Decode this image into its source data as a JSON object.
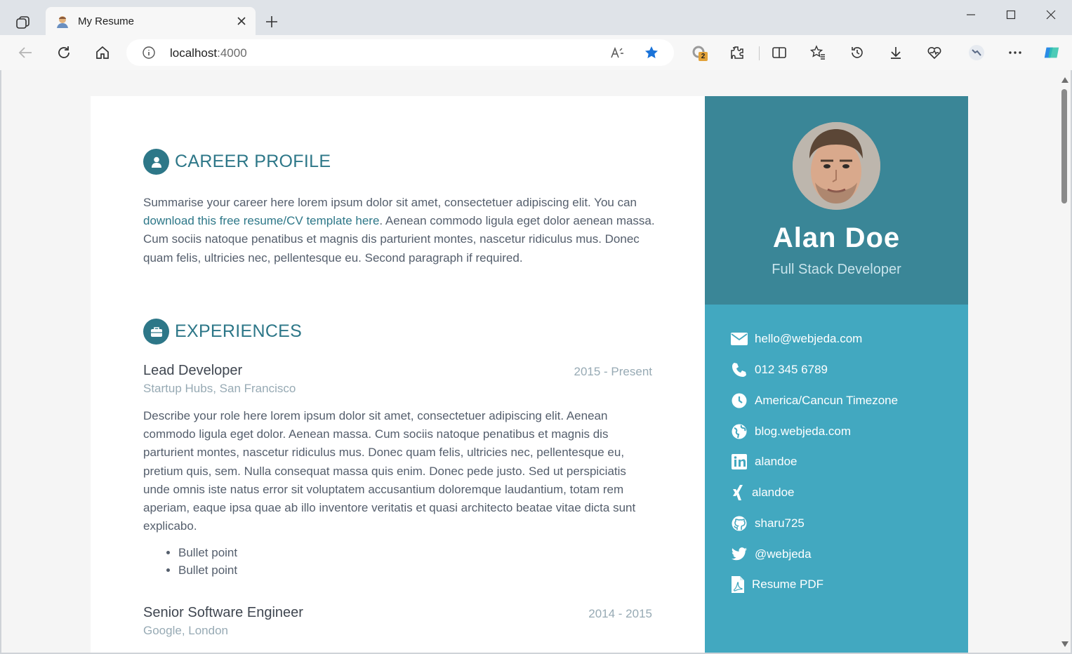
{
  "browser": {
    "tab": {
      "title": "My Resume"
    },
    "address": {
      "host": "localhost",
      "port": ":4000"
    },
    "extensions_badge": "2"
  },
  "profile": {
    "name": "Alan Doe",
    "tagline": "Full Stack Developer"
  },
  "contacts": [
    {
      "icon": "envelope-icon",
      "text": "hello@webjeda.com"
    },
    {
      "icon": "phone-icon",
      "text": "012 345 6789"
    },
    {
      "icon": "clock-icon",
      "text": "America/Cancun Timezone"
    },
    {
      "icon": "globe-icon",
      "text": "blog.webjeda.com"
    },
    {
      "icon": "linkedin-icon",
      "text": "alandoe"
    },
    {
      "icon": "xing-icon",
      "text": "alandoe"
    },
    {
      "icon": "github-icon",
      "text": "sharu725"
    },
    {
      "icon": "twitter-icon",
      "text": "@webjeda"
    },
    {
      "icon": "pdf-icon",
      "text": "Resume PDF"
    }
  ],
  "career_profile": {
    "title": "CAREER PROFILE",
    "summary_before": "Summarise your career here lorem ipsum dolor sit amet, consectetuer adipiscing elit. You can ",
    "summary_link": "download this free resume/CV template here",
    "summary_after": ". Aenean commodo ligula eget dolor aenean massa. Cum sociis natoque penatibus et magnis dis parturient montes, nascetur ridiculus mus. Donec quam felis, ultricies nec, pellentesque eu. Second paragraph if required."
  },
  "experiences": {
    "title": "EXPERIENCES",
    "items": [
      {
        "title": "Lead Developer",
        "time": "2015 - Present",
        "company": "Startup Hubs, San Francisco",
        "description": "Describe your role here lorem ipsum dolor sit amet, consectetuer adipiscing elit. Aenean commodo ligula eget dolor. Aenean massa. Cum sociis natoque penatibus et magnis dis parturient montes, nascetur ridiculus mus. Donec quam felis, ultricies nec, pellentesque eu, pretium quis, sem. Nulla consequat massa quis enim. Donec pede justo. Sed ut perspiciatis unde omnis iste natus error sit voluptatem accusantium doloremque laudantium, totam rem aperiam, eaque ipsa quae ab illo inventore veritatis et quasi architecto beatae vitae dicta sunt explicabo.",
        "bullets": [
          "Bullet point",
          "Bullet point"
        ]
      },
      {
        "title": "Senior Software Engineer",
        "time": "2014 - 2015",
        "company": "Google, London"
      }
    ]
  },
  "colors": {
    "accent": "#2d7788",
    "sidebar_top": "#3a8697",
    "sidebar": "#42a8c0"
  }
}
